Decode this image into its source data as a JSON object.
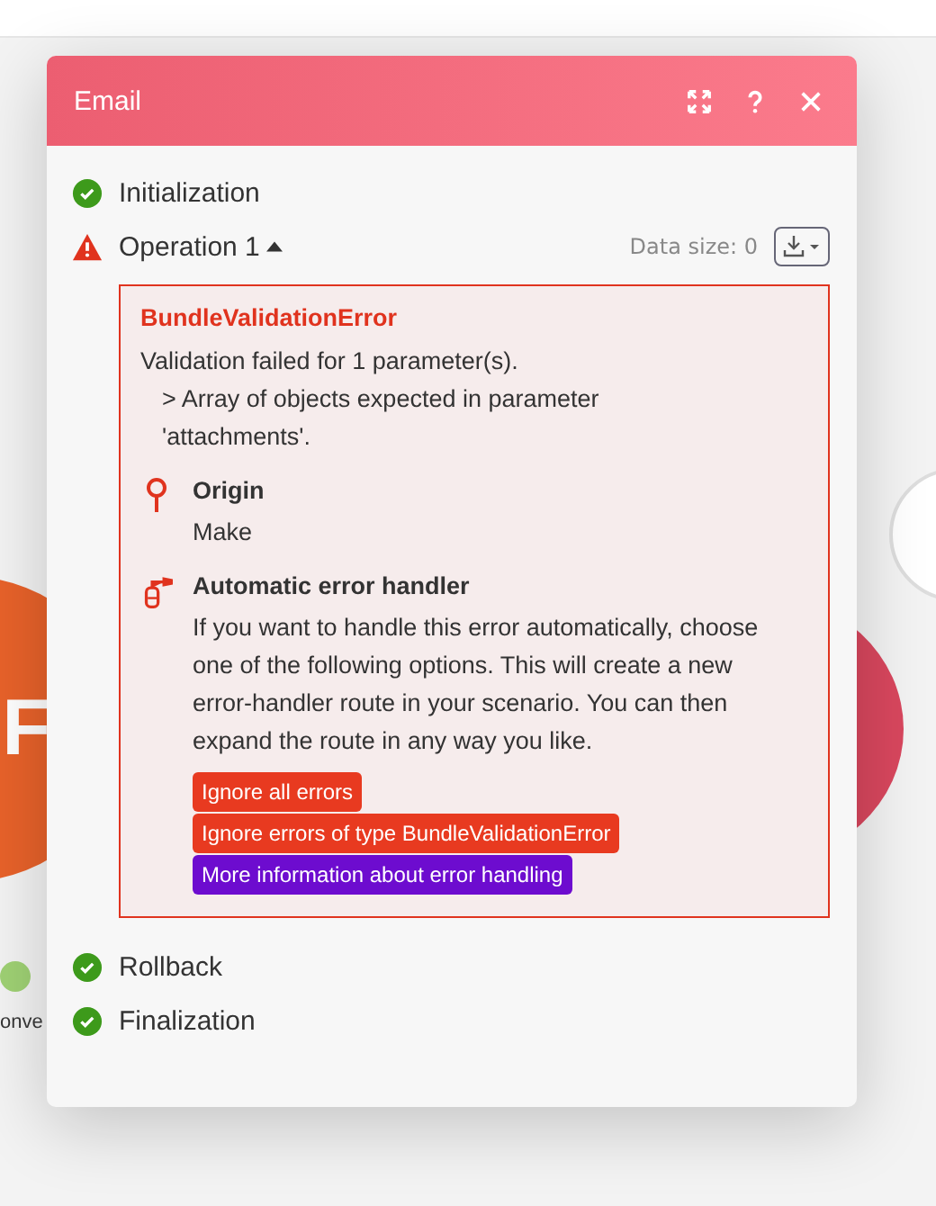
{
  "canvas": {
    "module_letter": "F",
    "module_caption": "onve"
  },
  "dialog": {
    "title": "Email",
    "steps": [
      {
        "label": "Initialization",
        "kind": "success"
      },
      {
        "label": "Operation 1",
        "kind": "error",
        "expanded": true,
        "data_size": "Data size: 0",
        "error": {
          "name": "BundleValidationError",
          "message": "Validation failed for 1 parameter(s).",
          "detail": "> Array of objects expected in parameter 'attachments'.",
          "origin_title": "Origin",
          "origin": "Make",
          "handler_title": "Automatic error handler",
          "handler_text": "If you want to handle this error automatically, choose one of the following options. This will create a new error-handler route in your scenario. You can then expand the route in any way you like.",
          "actions": [
            {
              "label": "Ignore all errors",
              "kind": "action"
            },
            {
              "label": "Ignore errors of type BundleValidationError",
              "kind": "action"
            },
            {
              "label": "More information about error handling",
              "kind": "info"
            }
          ]
        }
      },
      {
        "label": "Rollback",
        "kind": "success"
      },
      {
        "label": "Finalization",
        "kind": "success"
      }
    ]
  }
}
